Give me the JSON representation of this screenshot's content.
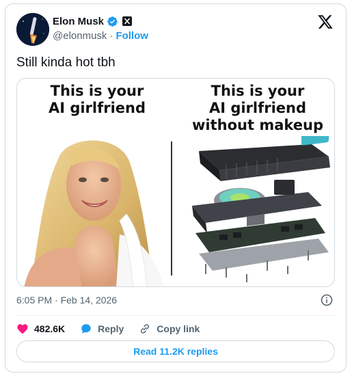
{
  "author": {
    "name": "Elon Musk",
    "handle": "@elonmusk",
    "separator": "·",
    "follow_label": "Follow"
  },
  "tweet": {
    "text": "Still kinda hot tbh",
    "timestamp": "6:05 PM · Feb 14, 2026"
  },
  "media": {
    "left_caption": [
      "This is your",
      "AI girlfriend"
    ],
    "right_caption": [
      "This is your",
      "AI girlfriend",
      "without makeup"
    ]
  },
  "actions": {
    "likes": "482.6K",
    "reply_label": "Reply",
    "copy_link_label": "Copy link",
    "read_replies_label": "Read 11.2K replies"
  },
  "icons": {
    "verified": "verified-badge-icon",
    "x_badge": "x-affiliate-icon",
    "x_logo": "x-logo-icon",
    "info": "info-icon",
    "like": "heart-icon",
    "reply": "chat-bubble-icon",
    "copy_link": "link-icon"
  },
  "colors": {
    "accent": "#1d9bf0",
    "like": "#f91880",
    "muted": "#536471",
    "border": "#cfd9de"
  }
}
